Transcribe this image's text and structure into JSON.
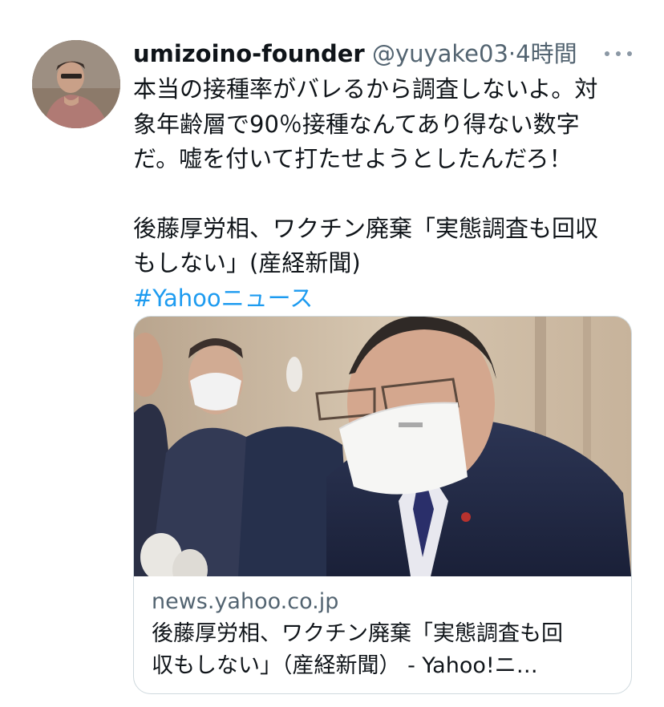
{
  "tweet": {
    "author_name": "umizoino-founder",
    "handle": "@yuyake03",
    "separator": "·",
    "time": "4時間",
    "text_lines": [
      "本当の接種率がバレるから調査しないよ。対",
      "象年齢層で90％接種なんてあり得ない数字",
      "だ。嘘を付いて打たせようとしたんだろ！"
    ],
    "news_headline_lines": [
      "後藤厚労相、ワクチン廃棄「実態調査も回収",
      "もしない」(産経新聞)"
    ],
    "hashtag": "#Yahooニュース"
  },
  "link_card": {
    "domain": "news.yahoo.co.jp",
    "title_lines": [
      "後藤厚労相、ワクチン廃棄「実態調査も回",
      "収もしない」（産経新聞） - Yahoo!ニ…"
    ]
  },
  "icons": {
    "more": "more-horizontal-icon",
    "avatar": "profile-avatar"
  },
  "colors": {
    "text": "#0f1419",
    "muted": "#536471",
    "link": "#1d9bf0",
    "border": "#cfd9de"
  }
}
